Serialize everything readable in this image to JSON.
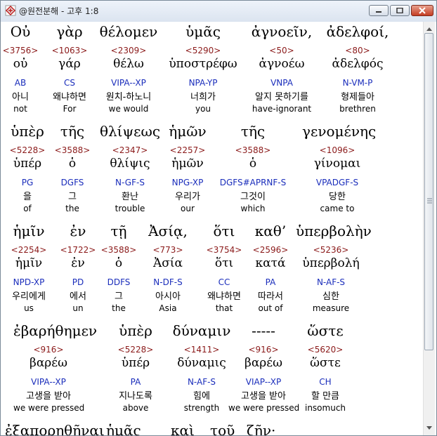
{
  "window": {
    "title": "@원전분해 - 고후 1:8",
    "min_symbol": "—",
    "max_symbol": "□",
    "close_symbol": "✕"
  },
  "rows": [
    {
      "words": [
        {
          "greek": "Οὐ",
          "strong": "<3756>",
          "lemma": "οὐ",
          "parse": "AB",
          "korean": "아니",
          "english": "not"
        },
        {
          "greek": "γὰρ",
          "strong": "<1063>",
          "lemma": "γάρ",
          "parse": "CS",
          "korean": "왜냐하면",
          "english": "For"
        },
        {
          "greek": "θέλομεν",
          "strong": "<2309>",
          "lemma": "θέλω",
          "parse": "VIPA--XP",
          "korean": "원치-하노니",
          "english": "we would"
        },
        {
          "greek": "ὑμᾶς",
          "strong": "<5290>",
          "lemma": "ὑποστρέφω",
          "parse": "NPA-YP",
          "korean": "너희가",
          "english": "you"
        },
        {
          "greek": "ἀγνοεῖν,",
          "strong": "<50>",
          "lemma": "ἀγνοέω",
          "parse": "VNPA",
          "korean": "알지 못하기를",
          "english": "have-ignorant"
        },
        {
          "greek": "ἀδελφοί,",
          "strong": "<80>",
          "lemma": "ἀδελφός",
          "parse": "N-VM-P",
          "korean": "형제들아",
          "english": "brethren"
        }
      ]
    },
    {
      "words": [
        {
          "greek": "ὑπὲρ",
          "strong": "<5228>",
          "lemma": "ὑπέρ",
          "parse": "PG",
          "korean": "을",
          "english": "of"
        },
        {
          "greek": "τῆς",
          "strong": "<3588>",
          "lemma": "ὁ",
          "parse": "DGFS",
          "korean": "그",
          "english": "the"
        },
        {
          "greek": "θλίψεως",
          "strong": "<2347>",
          "lemma": "θλίψις",
          "parse": "N-GF-S",
          "korean": "환난",
          "english": "trouble"
        },
        {
          "greek": "ἡμῶν",
          "strong": "<2257>",
          "lemma": "ἡμῶν",
          "parse": "NPG-XP",
          "korean": "우리가",
          "english": "our"
        },
        {
          "greek": "τῆς",
          "strong": "<3588>",
          "lemma": "ὁ",
          "parse": "DGFS#APRNF-S",
          "korean": "그것이",
          "english": "which"
        },
        {
          "greek": "γενομένης",
          "strong": "<1096>",
          "lemma": "γίνομαι",
          "parse": "VPADGF-S",
          "korean": "당한",
          "english": "came to"
        }
      ]
    },
    {
      "words": [
        {
          "greek": "ἡμῖν",
          "strong": "<2254>",
          "lemma": "ἡμῖν",
          "parse": "NPD-XP",
          "korean": "우리에게",
          "english": "us"
        },
        {
          "greek": "ἐν",
          "strong": "<1722>",
          "lemma": "ἐν",
          "parse": "PD",
          "korean": "에서",
          "english": "un"
        },
        {
          "greek": "τῇ",
          "strong": "<3588>",
          "lemma": "ὁ",
          "parse": "DDFS",
          "korean": "그",
          "english": "the"
        },
        {
          "greek": "Ἀσίᾳ,",
          "strong": "<773>",
          "lemma": "Ἀσία",
          "parse": "N-DF-S",
          "korean": "아시아",
          "english": "Asia"
        },
        {
          "greek": "ὅτι",
          "strong": "<3754>",
          "lemma": "ὅτι",
          "parse": "CC",
          "korean": "왜냐하면",
          "english": "that"
        },
        {
          "greek": "καθ’",
          "strong": "<2596>",
          "lemma": "κατά",
          "parse": "PA",
          "korean": "따라서",
          "english": "out of"
        },
        {
          "greek": "ὑπερβολὴν",
          "strong": "<5236>",
          "lemma": "ὑπερβολή",
          "parse": "N-AF-S",
          "korean": "심한",
          "english": "measure"
        }
      ]
    },
    {
      "words": [
        {
          "greek": "ἐβαρήθημεν",
          "strong": "<916>",
          "lemma": "βαρέω",
          "parse": "VIPA--XP",
          "korean": "고생을 받아",
          "english": "we were pressed"
        },
        {
          "greek": "ὑπὲρ",
          "strong": "<5228>",
          "lemma": "ὑπέρ",
          "parse": "PA",
          "korean": "지나도록",
          "english": "above"
        },
        {
          "greek": "δύναμιν",
          "strong": "<1411>",
          "lemma": "δύναμις",
          "parse": "N-AF-S",
          "korean": "힘에",
          "english": "strength"
        },
        {
          "greek": "-----",
          "strong": "<916>",
          "lemma": "βαρέω",
          "parse": "VIAP--XP",
          "korean": "고생을 받아",
          "english": "we were pressed"
        },
        {
          "greek": "ὥστε",
          "strong": "<5620>",
          "lemma": "ὥστε",
          "parse": "CH",
          "korean": "할 만큼",
          "english": "insomuch"
        }
      ]
    }
  ],
  "partial_row": [
    "ἐξαπορηθῆναι",
    "ἡμᾶς",
    "καὶ",
    "τοῦ",
    "ζῆν·"
  ]
}
